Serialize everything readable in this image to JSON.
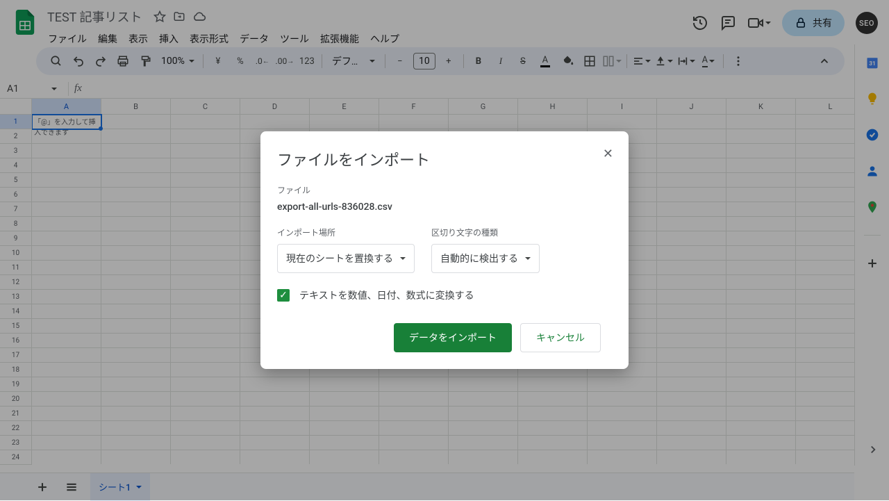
{
  "header": {
    "doc_title": "TEST 記事リスト",
    "share_label": "共有",
    "avatar_text": "SEO"
  },
  "menu": {
    "items": [
      "ファイル",
      "編集",
      "表示",
      "挿入",
      "表示形式",
      "データ",
      "ツール",
      "拡張機能",
      "ヘルプ"
    ]
  },
  "toolbar": {
    "zoom": "100%",
    "currency": "¥",
    "percent": "%",
    "auto_format": "123",
    "font_family": "デフォ...",
    "font_size": "10"
  },
  "name_box": "A1",
  "grid": {
    "columns": [
      "A",
      "B",
      "C",
      "D",
      "E",
      "F",
      "G",
      "H",
      "I",
      "J",
      "K",
      "L"
    ],
    "row_count": 24,
    "a1_placeholder": "「@」を入力して挿入できます"
  },
  "sheet_tab": {
    "name": "シート1"
  },
  "dialog": {
    "title": "ファイルをインポート",
    "file_section_label": "ファイル",
    "filename": "export-all-urls-836028.csv",
    "import_location_label": "インポート場所",
    "import_location_value": "現在のシートを置換する",
    "delimiter_label": "区切り文字の種類",
    "delimiter_value": "自動的に検出する",
    "convert_checkbox_checked": true,
    "convert_label": "テキストを数値、日付、数式に変換する",
    "primary_btn": "データをインポート",
    "secondary_btn": "キャンセル"
  }
}
